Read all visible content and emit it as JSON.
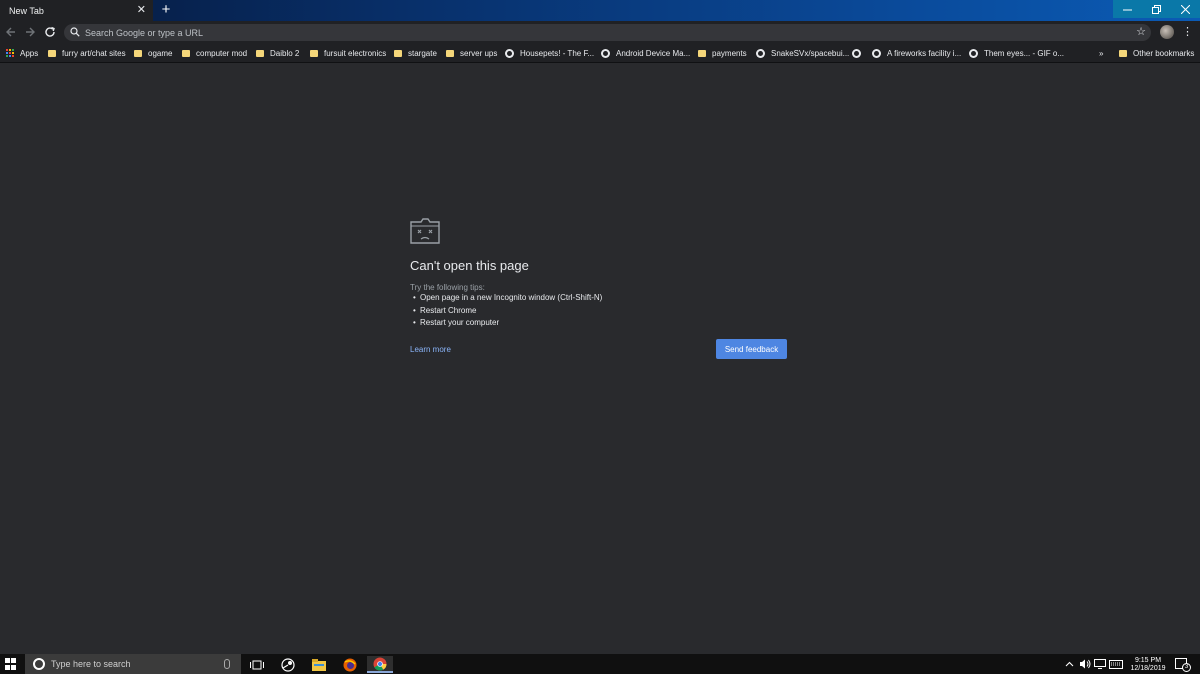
{
  "browser": {
    "tab": {
      "title": "New Tab"
    },
    "omnibox": {
      "placeholder": "Search Google or type a URL"
    },
    "bookmarks": {
      "apps_label": "Apps",
      "items": [
        {
          "label": "furry art/chat sites",
          "icon": "folder"
        },
        {
          "label": "ogame",
          "icon": "folder"
        },
        {
          "label": "computer mod",
          "icon": "folder"
        },
        {
          "label": "Daiblo 2",
          "icon": "folder"
        },
        {
          "label": "fursuit electronics",
          "icon": "folder"
        },
        {
          "label": "stargate",
          "icon": "folder"
        },
        {
          "label": "server ups",
          "icon": "folder"
        },
        {
          "label": "Housepets! - The F...",
          "icon": "globe"
        },
        {
          "label": "Android Device Ma...",
          "icon": "globe"
        },
        {
          "label": "payments",
          "icon": "folder"
        },
        {
          "label": "SnakeSVx/spacebui...",
          "icon": "globe"
        },
        {
          "label": "",
          "icon": "globe"
        },
        {
          "label": "A fireworks facility i...",
          "icon": "globe"
        },
        {
          "label": "Them eyes... - GIF o...",
          "icon": "globe"
        }
      ],
      "overflow": "»",
      "other_label": "Other bookmarks"
    }
  },
  "error": {
    "title": "Can't open this page",
    "tips_heading": "Try the following tips:",
    "tips": [
      "Open page in a new Incognito window (Ctrl-Shift-N)",
      "Restart Chrome",
      "Restart your computer"
    ],
    "learn_more": "Learn more",
    "feedback_button": "Send feedback"
  },
  "taskbar": {
    "search_placeholder": "Type here to search",
    "time": "9:15 PM",
    "date": "12/18/2019",
    "notification_count": "3"
  },
  "colors": {
    "page_bg": "#292a2d",
    "link": "#8ab4f8",
    "button": "#4e86e2",
    "folder": "#f5d77a"
  }
}
